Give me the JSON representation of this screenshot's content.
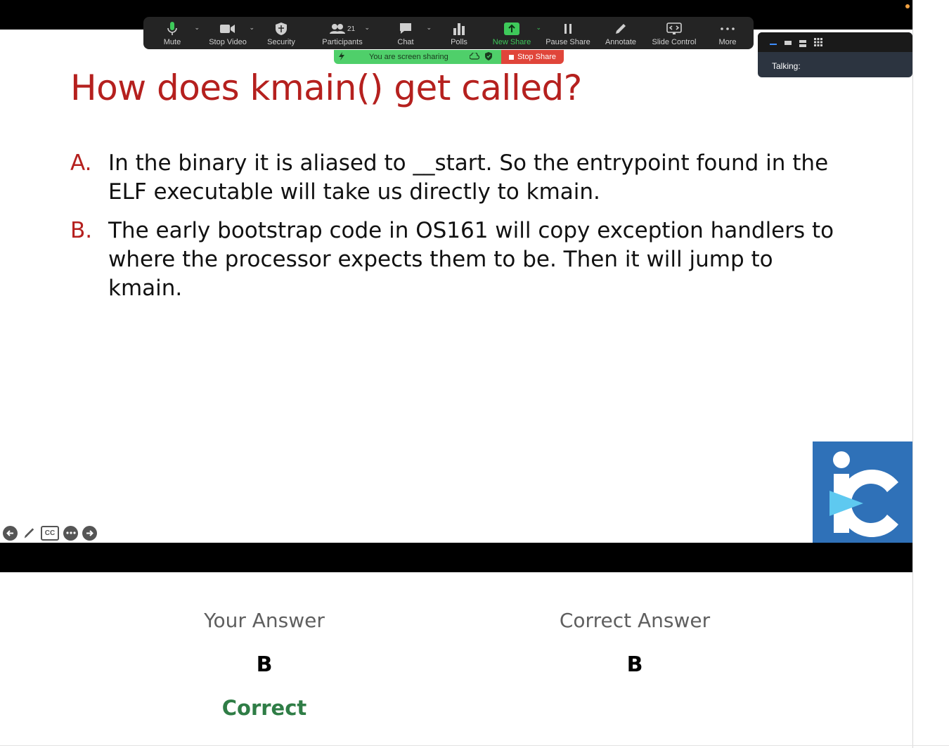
{
  "toolbar": {
    "mute": "Mute",
    "stop_video": "Stop Video",
    "security": "Security",
    "participants": "Participants",
    "participants_count": "21",
    "chat": "Chat",
    "polls": "Polls",
    "new_share": "New Share",
    "pause_share": "Pause Share",
    "annotate": "Annotate",
    "slide_control": "Slide Control",
    "more": "More"
  },
  "sharing_bar": {
    "status": "You are screen sharing",
    "stop_label": "Stop Share"
  },
  "talking_panel": {
    "label": "Talking:"
  },
  "slide": {
    "title": "How does kmain() get called?",
    "options": [
      {
        "letter": "A.",
        "text": "In the binary it is aliased to __start. So the entrypoint found in the ELF executable will take us directly to kmain."
      },
      {
        "letter": "B.",
        "text": "The early bootstrap code in OS161 will copy exception handlers to where the processor expects them to be. Then it will jump to kmain."
      }
    ],
    "controls": {
      "cc": "CC"
    }
  },
  "answers": {
    "your_heading": "Your Answer",
    "your_value": "B",
    "status": "Correct",
    "correct_heading": "Correct Answer",
    "correct_value": "B"
  },
  "colors": {
    "title_red": "#b5201e",
    "correct_green": "#2f7d46",
    "share_green": "#4fcf6a",
    "stop_red": "#e0453a",
    "logo_blue": "#2f71b8"
  }
}
